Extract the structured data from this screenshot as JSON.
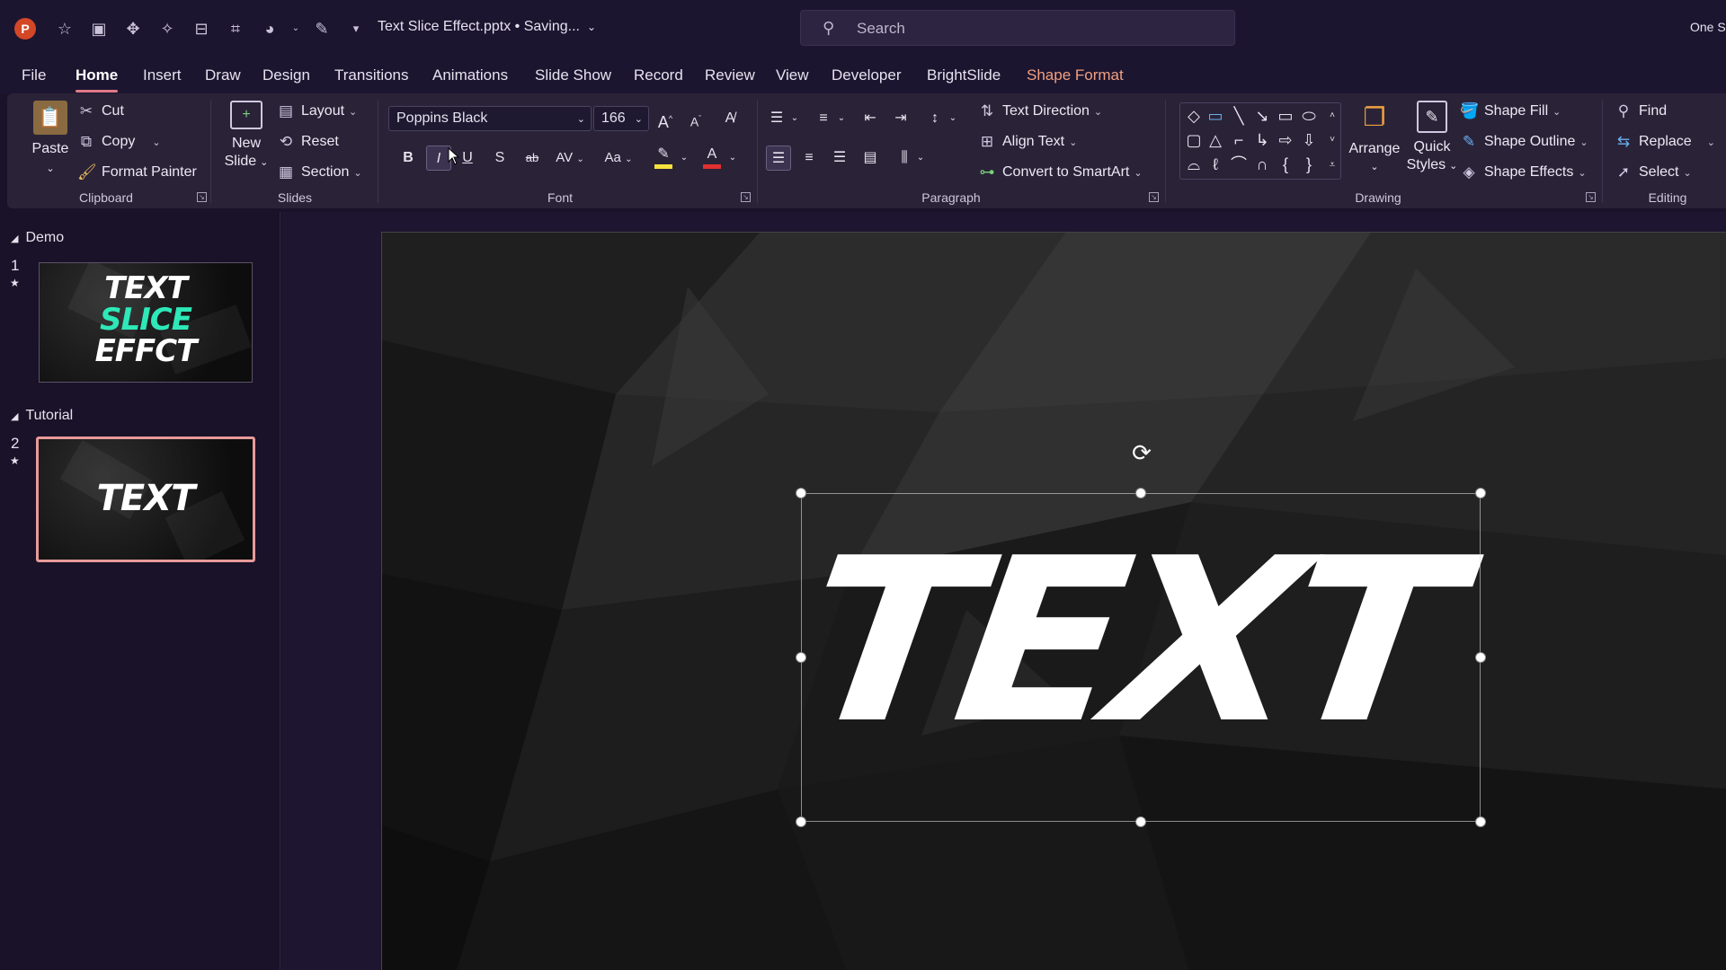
{
  "titlebar": {
    "app_logo": "P",
    "quick_access": [
      "star-icon",
      "screenshot-icon",
      "move-icon",
      "magic-icon",
      "align-icon",
      "crop-icon",
      "shapes-icon",
      "dropdown-icon",
      "pen-icon",
      "customize-icon"
    ],
    "doc_title": "Text Slice Effect.pptx • Saving...",
    "search_placeholder": "Search",
    "right_text": "One S"
  },
  "tabs": [
    {
      "label": "File"
    },
    {
      "label": "Home",
      "active": true
    },
    {
      "label": "Insert"
    },
    {
      "label": "Draw"
    },
    {
      "label": "Design"
    },
    {
      "label": "Transitions"
    },
    {
      "label": "Animations"
    },
    {
      "label": "Slide Show"
    },
    {
      "label": "Record"
    },
    {
      "label": "Review"
    },
    {
      "label": "View"
    },
    {
      "label": "Developer"
    },
    {
      "label": "BrightSlide"
    },
    {
      "label": "Shape Format"
    }
  ],
  "ribbon": {
    "clipboard": {
      "label": "Clipboard",
      "paste": "Paste",
      "cut": "Cut",
      "copy": "Copy",
      "format_painter": "Format Painter"
    },
    "slides": {
      "label": "Slides",
      "new_slide_line1": "New",
      "new_slide_line2": "Slide",
      "layout": "Layout",
      "reset": "Reset",
      "section": "Section"
    },
    "font": {
      "label": "Font",
      "font_name": "Poppins Black",
      "font_size": "166",
      "bold": "B",
      "italic": "I",
      "underline": "U",
      "shadow": "S",
      "strikethrough": "ab",
      "spacing": "AV",
      "change_case": "Aa",
      "grow": "A",
      "shrink": "A",
      "font_color": "A"
    },
    "paragraph": {
      "label": "Paragraph",
      "text_direction": "Text Direction",
      "align_text": "Align Text",
      "convert_smartart": "Convert to SmartArt"
    },
    "drawing": {
      "label": "Drawing",
      "arrange": "Arrange",
      "quick_styles_line1": "Quick",
      "quick_styles_line2": "Styles",
      "shape_fill": "Shape Fill",
      "shape_outline": "Shape Outline",
      "shape_effects": "Shape Effects"
    },
    "editing": {
      "label": "Editing",
      "find": "Find",
      "replace": "Replace",
      "select": "Select"
    }
  },
  "slide_panel": {
    "sections": [
      {
        "name": "Demo",
        "slides": [
          {
            "number": "1",
            "lines": [
              "TEXT",
              "SLICE",
              "EFFCT"
            ]
          }
        ]
      },
      {
        "name": "Tutorial",
        "slides": [
          {
            "number": "2",
            "lines": [
              "TEXT"
            ]
          }
        ]
      }
    ]
  },
  "canvas": {
    "slide_text": "TEXT"
  },
  "colors": {
    "accent_tab_underline": "#e07a8a",
    "shape_format_tab": "#f0a080",
    "selected_thumb_border": "#e89a9a",
    "slice_accent": "#2ee8b8",
    "highlight_yellow": "#f5e23c",
    "font_color_red": "#e03030"
  }
}
